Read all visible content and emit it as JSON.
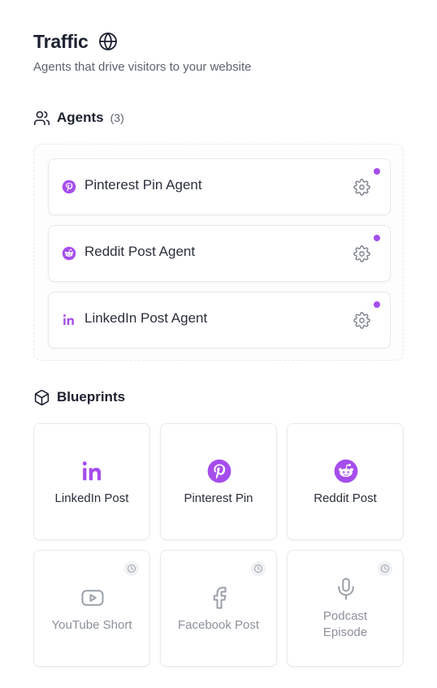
{
  "header": {
    "title": "Traffic",
    "subtitle": "Agents that drive visitors to your website",
    "title_icon": "globe-icon"
  },
  "agents": {
    "title": "Agents",
    "count": "(3)",
    "icon": "users-icon",
    "items": [
      {
        "label": "Pinterest Pin Agent",
        "icon": "pinterest-icon",
        "status": "active"
      },
      {
        "label": "Reddit Post Agent",
        "icon": "reddit-icon",
        "status": "active"
      },
      {
        "label": "LinkedIn Post Agent",
        "icon": "linkedin-icon",
        "status": "active"
      }
    ]
  },
  "blueprints": {
    "title": "Blueprints",
    "icon": "box-icon",
    "items": [
      {
        "label": "LinkedIn Post",
        "icon": "linkedin-icon",
        "available": true
      },
      {
        "label": "Pinterest Pin",
        "icon": "pinterest-icon",
        "available": true
      },
      {
        "label": "Reddit Post",
        "icon": "reddit-icon",
        "available": true
      },
      {
        "label": "YouTube Short",
        "icon": "youtube-icon",
        "available": false
      },
      {
        "label": "Facebook Post",
        "icon": "facebook-icon",
        "available": false
      },
      {
        "label": "Podcast Episode",
        "icon": "microphone-icon",
        "available": false
      }
    ]
  },
  "colors": {
    "accent": "#a64ded",
    "muted_icon": "#9aa0a8",
    "text": "#1c2130"
  }
}
